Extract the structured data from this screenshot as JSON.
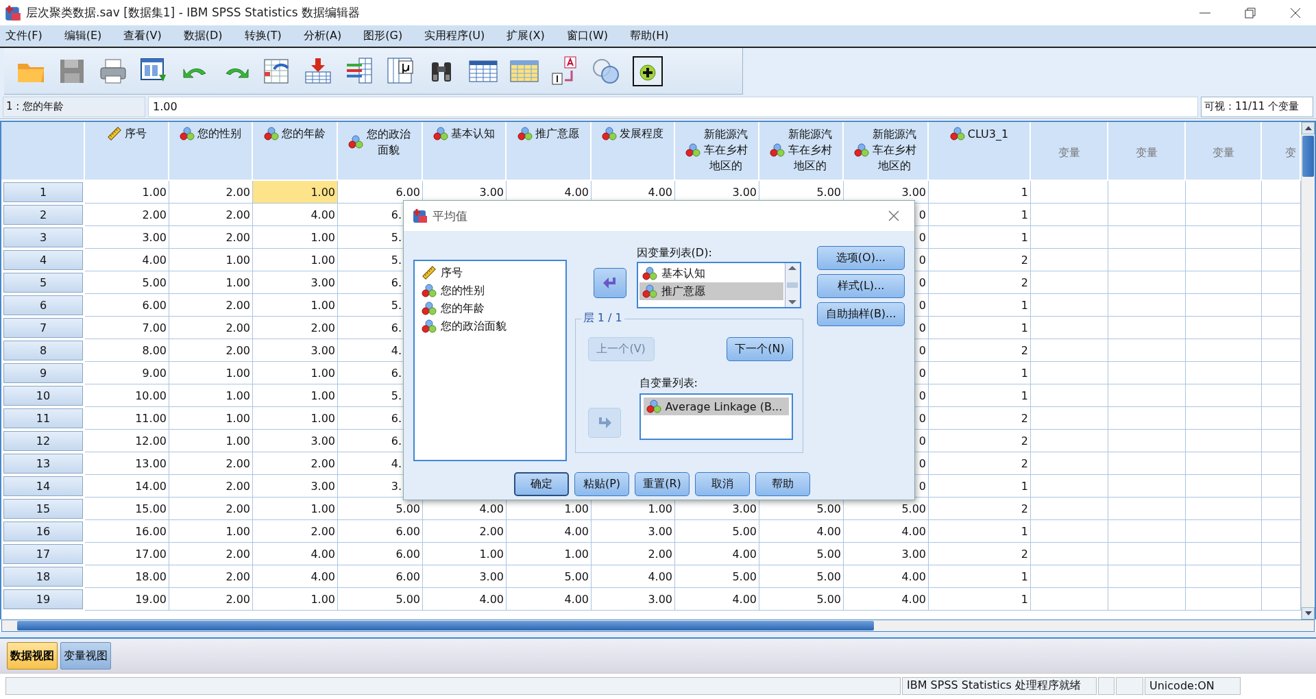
{
  "window": {
    "title": "层次聚类数据.sav [数据集1] - IBM SPSS Statistics 数据编辑器"
  },
  "menu": [
    "文件(F)",
    "编辑(E)",
    "查看(V)",
    "数据(D)",
    "转换(T)",
    "分析(A)",
    "图形(G)",
    "实用程序(U)",
    "扩展(X)",
    "窗口(W)",
    "帮助(H)"
  ],
  "cell_bar": {
    "reference": "1 : 您的年龄",
    "value": "1.00",
    "visible": "可视：11/11 个变量"
  },
  "table": {
    "columns": [
      {
        "label": "序号",
        "kind": "scale"
      },
      {
        "label": "您的性别",
        "kind": "nominal"
      },
      {
        "label": "您的年龄",
        "kind": "nominal"
      },
      {
        "label": "您的政治面貌",
        "kind": "nominal"
      },
      {
        "label": "基本认知",
        "kind": "nominal"
      },
      {
        "label": "推广意愿",
        "kind": "nominal"
      },
      {
        "label": "发展程度",
        "kind": "nominal"
      },
      {
        "label": "新能源汽车在乡村地区的",
        "kind": "nominal"
      },
      {
        "label": "新能源汽车在乡村地区的",
        "kind": "nominal"
      },
      {
        "label": "新能源汽车在乡村地区的",
        "kind": "nominal"
      },
      {
        "label": "CLU3_1",
        "kind": "nominal"
      },
      {
        "label": "变量",
        "kind": "empty"
      },
      {
        "label": "变量",
        "kind": "empty"
      },
      {
        "label": "变量",
        "kind": "empty"
      },
      {
        "label": "变",
        "kind": "empty"
      }
    ],
    "rows": [
      {
        "number": "1",
        "cells": [
          {
            "text": "1.00",
            "selected": false
          },
          {
            "text": "2.00",
            "selected": false
          },
          {
            "text": "1.00",
            "selected": true
          },
          {
            "text": "6.00",
            "selected": false
          },
          {
            "text": "3.00",
            "selected": false
          },
          {
            "text": "4.00",
            "selected": false
          },
          {
            "text": "4.00",
            "selected": false
          },
          {
            "text": "3.00",
            "selected": false
          },
          {
            "text": "5.00",
            "selected": false
          },
          {
            "text": "3.00",
            "selected": false
          },
          {
            "text": "1",
            "selected": false
          }
        ]
      },
      {
        "number": "2",
        "left": [
          {
            "text": "2.00",
            "selected": false
          },
          {
            "text": "2.00",
            "selected": false
          },
          {
            "text": "4.00",
            "selected": false
          },
          {
            "text": "6.",
            "selected": false
          }
        ],
        "right": [
          {
            "text": "0",
            "selected": false
          },
          {
            "text": "1",
            "selected": false
          }
        ]
      },
      {
        "number": "3",
        "left": [
          {
            "text": "3.00",
            "selected": false
          },
          {
            "text": "2.00",
            "selected": false
          },
          {
            "text": "1.00",
            "selected": false
          },
          {
            "text": "5.",
            "selected": false
          }
        ],
        "right": [
          {
            "text": "0",
            "selected": false
          },
          {
            "text": "1",
            "selected": false
          }
        ]
      },
      {
        "number": "4",
        "left": [
          {
            "text": "4.00",
            "selected": false
          },
          {
            "text": "1.00",
            "selected": false
          },
          {
            "text": "1.00",
            "selected": false
          },
          {
            "text": "5.",
            "selected": false
          }
        ],
        "right": [
          {
            "text": "0",
            "selected": false
          },
          {
            "text": "2",
            "selected": false
          }
        ]
      },
      {
        "number": "5",
        "left": [
          {
            "text": "5.00",
            "selected": false
          },
          {
            "text": "1.00",
            "selected": false
          },
          {
            "text": "3.00",
            "selected": false
          },
          {
            "text": "6.",
            "selected": false
          }
        ],
        "right": [
          {
            "text": "0",
            "selected": false
          },
          {
            "text": "2",
            "selected": false
          }
        ]
      },
      {
        "number": "6",
        "left": [
          {
            "text": "6.00",
            "selected": false
          },
          {
            "text": "2.00",
            "selected": false
          },
          {
            "text": "1.00",
            "selected": false
          },
          {
            "text": "5.",
            "selected": false
          }
        ],
        "right": [
          {
            "text": "0",
            "selected": false
          },
          {
            "text": "1",
            "selected": false
          }
        ]
      },
      {
        "number": "7",
        "left": [
          {
            "text": "7.00",
            "selected": false
          },
          {
            "text": "2.00",
            "selected": false
          },
          {
            "text": "2.00",
            "selected": false
          },
          {
            "text": "6.",
            "selected": false
          }
        ],
        "right": [
          {
            "text": "0",
            "selected": false
          },
          {
            "text": "1",
            "selected": false
          }
        ]
      },
      {
        "number": "8",
        "left": [
          {
            "text": "8.00",
            "selected": false
          },
          {
            "text": "2.00",
            "selected": false
          },
          {
            "text": "3.00",
            "selected": false
          },
          {
            "text": "4.",
            "selected": false
          }
        ],
        "right": [
          {
            "text": "0",
            "selected": false
          },
          {
            "text": "2",
            "selected": false
          }
        ]
      },
      {
        "number": "9",
        "left": [
          {
            "text": "9.00",
            "selected": false
          },
          {
            "text": "1.00",
            "selected": false
          },
          {
            "text": "1.00",
            "selected": false
          },
          {
            "text": "6.",
            "selected": false
          }
        ],
        "right": [
          {
            "text": "0",
            "selected": false
          },
          {
            "text": "1",
            "selected": false
          }
        ]
      },
      {
        "number": "10",
        "left": [
          {
            "text": "10.00",
            "selected": false
          },
          {
            "text": "1.00",
            "selected": false
          },
          {
            "text": "1.00",
            "selected": false
          },
          {
            "text": "5.",
            "selected": false
          }
        ],
        "right": [
          {
            "text": "0",
            "selected": false
          },
          {
            "text": "1",
            "selected": false
          }
        ]
      },
      {
        "number": "11",
        "left": [
          {
            "text": "11.00",
            "selected": false
          },
          {
            "text": "1.00",
            "selected": false
          },
          {
            "text": "1.00",
            "selected": false
          },
          {
            "text": "6.",
            "selected": false
          }
        ],
        "right": [
          {
            "text": "0",
            "selected": false
          },
          {
            "text": "2",
            "selected": false
          }
        ]
      },
      {
        "number": "12",
        "left": [
          {
            "text": "12.00",
            "selected": false
          },
          {
            "text": "1.00",
            "selected": false
          },
          {
            "text": "3.00",
            "selected": false
          },
          {
            "text": "6.",
            "selected": false
          }
        ],
        "right": [
          {
            "text": "0",
            "selected": false
          },
          {
            "text": "2",
            "selected": false
          }
        ]
      },
      {
        "number": "13",
        "left": [
          {
            "text": "13.00",
            "selected": false
          },
          {
            "text": "2.00",
            "selected": false
          },
          {
            "text": "2.00",
            "selected": false
          },
          {
            "text": "4.",
            "selected": false
          }
        ],
        "right": [
          {
            "text": "0",
            "selected": false
          },
          {
            "text": "2",
            "selected": false
          }
        ]
      },
      {
        "number": "14",
        "left": [
          {
            "text": "14.00",
            "selected": false
          },
          {
            "text": "2.00",
            "selected": false
          },
          {
            "text": "3.00",
            "selected": false
          },
          {
            "text": "3.",
            "selected": false
          }
        ],
        "right": [
          {
            "text": "0",
            "selected": false
          },
          {
            "text": "1",
            "selected": false
          }
        ]
      },
      {
        "number": "15",
        "cells": [
          {
            "text": "15.00",
            "selected": false
          },
          {
            "text": "2.00",
            "selected": false
          },
          {
            "text": "1.00",
            "selected": false
          },
          {
            "text": "5.00",
            "selected": false
          },
          {
            "text": "4.00",
            "selected": false
          },
          {
            "text": "1.00",
            "selected": false
          },
          {
            "text": "1.00",
            "selected": false
          },
          {
            "text": "3.00",
            "selected": false
          },
          {
            "text": "5.00",
            "selected": false
          },
          {
            "text": "5.00",
            "selected": false
          },
          {
            "text": "2",
            "selected": false
          }
        ]
      },
      {
        "number": "16",
        "cells": [
          {
            "text": "16.00",
            "selected": false
          },
          {
            "text": "1.00",
            "selected": false
          },
          {
            "text": "2.00",
            "selected": false
          },
          {
            "text": "6.00",
            "selected": false
          },
          {
            "text": "2.00",
            "selected": false
          },
          {
            "text": "4.00",
            "selected": false
          },
          {
            "text": "3.00",
            "selected": false
          },
          {
            "text": "5.00",
            "selected": false
          },
          {
            "text": "4.00",
            "selected": false
          },
          {
            "text": "4.00",
            "selected": false
          },
          {
            "text": "1",
            "selected": false
          }
        ]
      },
      {
        "number": "17",
        "cells": [
          {
            "text": "17.00",
            "selected": false
          },
          {
            "text": "2.00",
            "selected": false
          },
          {
            "text": "4.00",
            "selected": false
          },
          {
            "text": "6.00",
            "selected": false
          },
          {
            "text": "1.00",
            "selected": false
          },
          {
            "text": "1.00",
            "selected": false
          },
          {
            "text": "2.00",
            "selected": false
          },
          {
            "text": "4.00",
            "selected": false
          },
          {
            "text": "5.00",
            "selected": false
          },
          {
            "text": "3.00",
            "selected": false
          },
          {
            "text": "2",
            "selected": false
          }
        ]
      },
      {
        "number": "18",
        "cells": [
          {
            "text": "18.00",
            "selected": false
          },
          {
            "text": "2.00",
            "selected": false
          },
          {
            "text": "4.00",
            "selected": false
          },
          {
            "text": "6.00",
            "selected": false
          },
          {
            "text": "3.00",
            "selected": false
          },
          {
            "text": "5.00",
            "selected": false
          },
          {
            "text": "4.00",
            "selected": false
          },
          {
            "text": "5.00",
            "selected": false
          },
          {
            "text": "5.00",
            "selected": false
          },
          {
            "text": "4.00",
            "selected": false
          },
          {
            "text": "1",
            "selected": false
          }
        ]
      },
      {
        "number": "19",
        "cells": [
          {
            "text": "19.00",
            "selected": false
          },
          {
            "text": "2.00",
            "selected": false
          },
          {
            "text": "1.00",
            "selected": false
          },
          {
            "text": "5.00",
            "selected": false
          },
          {
            "text": "4.00",
            "selected": false
          },
          {
            "text": "4.00",
            "selected": false
          },
          {
            "text": "3.00",
            "selected": false
          },
          {
            "text": "4.00",
            "selected": false
          },
          {
            "text": "5.00",
            "selected": false
          },
          {
            "text": "4.00",
            "selected": false
          },
          {
            "text": "1",
            "selected": false
          }
        ]
      }
    ]
  },
  "view_tabs": [
    {
      "label": "数据视图",
      "selected": true
    },
    {
      "label": "变量视图",
      "selected": false
    }
  ],
  "status_bar": [
    "IBM SPSS Statistics 处理程序就绪",
    "Unicode:ON"
  ],
  "dialog": {
    "title": "平均值",
    "source_list": [
      {
        "label": "序号",
        "kind": "scale",
        "selected": false
      },
      {
        "label": "您的性别",
        "kind": "nominal",
        "selected": false
      },
      {
        "label": "您的年龄",
        "kind": "nominal",
        "selected": false
      },
      {
        "label": "您的政治面貌",
        "kind": "nominal",
        "selected": false
      }
    ],
    "move_buttons": [
      {
        "kind": "left",
        "disabled": false
      },
      {
        "kind": "right",
        "disabled": true
      }
    ],
    "dependent": {
      "label": "因变量列表(D):",
      "items": [
        {
          "label": "基本认知",
          "kind": "nominal",
          "selected": false
        },
        {
          "label": "推广意愿",
          "kind": "nominal",
          "selected": true
        }
      ]
    },
    "side_buttons": [
      "选项(O)...",
      "样式(L)...",
      "自助抽样(B)..."
    ],
    "layer": {
      "legend": "层 1 / 1",
      "previous": {
        "label": "上一个(V)",
        "disabled": true
      },
      "next": {
        "label": "下一个(N)",
        "disabled": false
      }
    },
    "independent": {
      "label": "自变量列表:",
      "items": [
        {
          "label": "Average Linkage (B...",
          "kind": "nominal",
          "selected": true
        }
      ]
    },
    "buttons": [
      {
        "label": "确定",
        "default": true
      },
      {
        "label": "粘贴(P)",
        "default": false
      },
      {
        "label": "重置(R)",
        "default": false
      },
      {
        "label": "取消",
        "default": false
      },
      {
        "label": "帮助",
        "default": false
      }
    ]
  }
}
